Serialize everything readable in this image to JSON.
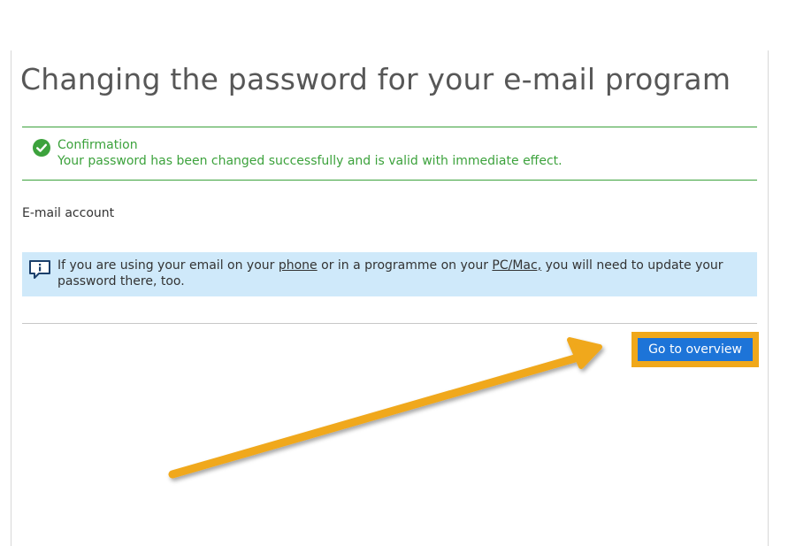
{
  "page": {
    "title": "Changing the password for your e-mail program"
  },
  "confirmation": {
    "title": "Confirmation",
    "message": "Your password has been changed successfully and is valid with immediate effect."
  },
  "account": {
    "label": "E-mail account"
  },
  "info": {
    "text_before": "If you are using your email on your ",
    "link_phone": "phone",
    "text_middle": " or in a programme on your ",
    "link_pc": "PC/Mac,",
    "text_after": " you will need to update your password there, too."
  },
  "actions": {
    "overview_label": "Go to overview"
  },
  "icons": {
    "confirmation": "check-circle-icon",
    "info": "info-speech-bubble-icon",
    "annotation": "arrow-annotation-icon"
  },
  "colors": {
    "success": "#3ca23c",
    "info_background": "#cfe9fa",
    "primary_button": "#1d74d8",
    "highlight": "#f0a81a"
  }
}
